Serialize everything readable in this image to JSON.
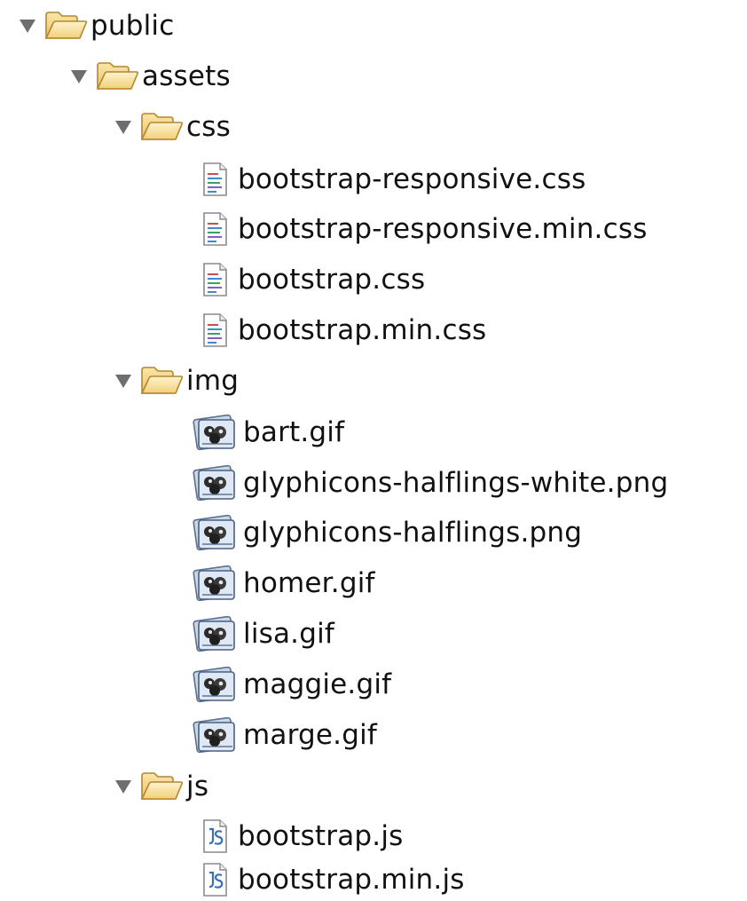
{
  "tree": {
    "root": {
      "name": "public",
      "icon": "folder-open-icon",
      "expanded": true,
      "children": {
        "assets": {
          "name": "assets",
          "icon": "folder-open-icon",
          "expanded": true,
          "css": {
            "name": "css",
            "icon": "folder-open-icon",
            "expanded": true,
            "files": [
              {
                "name": "bootstrap-responsive.css",
                "icon": "css-file-icon"
              },
              {
                "name": "bootstrap-responsive.min.css",
                "icon": "css-file-icon"
              },
              {
                "name": "bootstrap.css",
                "icon": "css-file-icon"
              },
              {
                "name": "bootstrap.min.css",
                "icon": "css-file-icon"
              }
            ]
          },
          "img": {
            "name": "img",
            "icon": "folder-open-icon",
            "expanded": true,
            "files": [
              {
                "name": "bart.gif",
                "icon": "image-file-icon"
              },
              {
                "name": "glyphicons-halflings-white.png",
                "icon": "image-file-icon"
              },
              {
                "name": "glyphicons-halflings.png",
                "icon": "image-file-icon"
              },
              {
                "name": "homer.gif",
                "icon": "image-file-icon"
              },
              {
                "name": "lisa.gif",
                "icon": "image-file-icon"
              },
              {
                "name": "maggie.gif",
                "icon": "image-file-icon"
              },
              {
                "name": "marge.gif",
                "icon": "image-file-icon"
              }
            ]
          },
          "js": {
            "name": "js",
            "icon": "folder-open-icon",
            "expanded": true,
            "files": [
              {
                "name": "bootstrap.js",
                "icon": "js-file-icon"
              },
              {
                "name": "bootstrap.min.js",
                "icon": "js-file-icon"
              }
            ]
          }
        }
      }
    }
  },
  "colors": {
    "twisty": "#6b6b6b",
    "folder_fill": "#f5d98a",
    "folder_stroke": "#b58a2a",
    "text": "#111111"
  }
}
